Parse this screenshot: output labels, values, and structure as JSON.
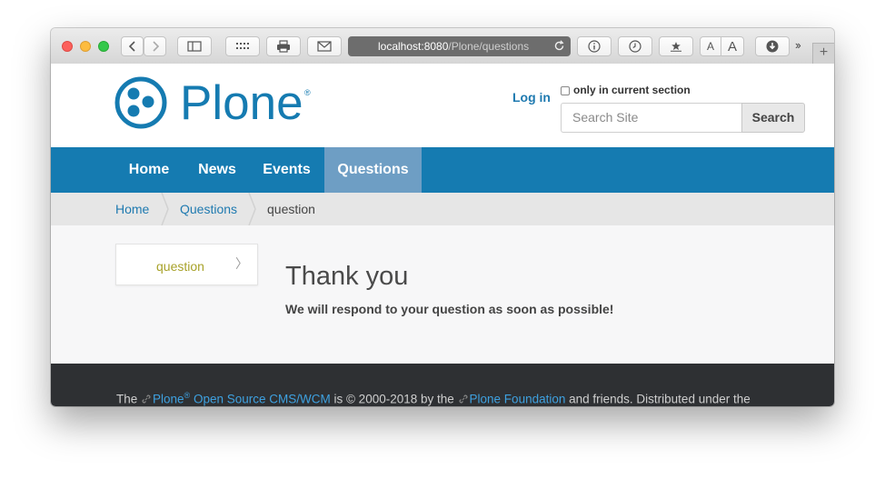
{
  "browser": {
    "url_host": "localhost:8080",
    "url_path": "/Plone/questions"
  },
  "site": {
    "logo_text": "Plone",
    "logo_mark": "®",
    "login_label": "Log in",
    "only_current_section_label": "only in current section",
    "search_placeholder": "Search Site",
    "search_button_label": "Search"
  },
  "nav": {
    "items": [
      {
        "label": "Home",
        "active": false
      },
      {
        "label": "News",
        "active": false
      },
      {
        "label": "Events",
        "active": false
      },
      {
        "label": "Questions",
        "active": true
      }
    ]
  },
  "breadcrumbs": {
    "items": [
      "Home",
      "Questions"
    ],
    "current": "question"
  },
  "portlet": {
    "label": "question"
  },
  "content": {
    "title": "Thank you",
    "description": "We will respond to your question as soon as possible!"
  },
  "footer": {
    "prefix": "The ",
    "plone_link": "Plone",
    "plone_mark": "®",
    "cms_link": " Open Source CMS/WCM",
    "middle": " is © 2000-2018 by the ",
    "foundation_link": "Plone Foundation",
    "suffix": " and friends. Distributed under the"
  },
  "colors": {
    "brand": "#157bb1",
    "nav_active": "#6e9ec4",
    "link": "#1f7ab0",
    "footer_bg": "#2e3033"
  }
}
